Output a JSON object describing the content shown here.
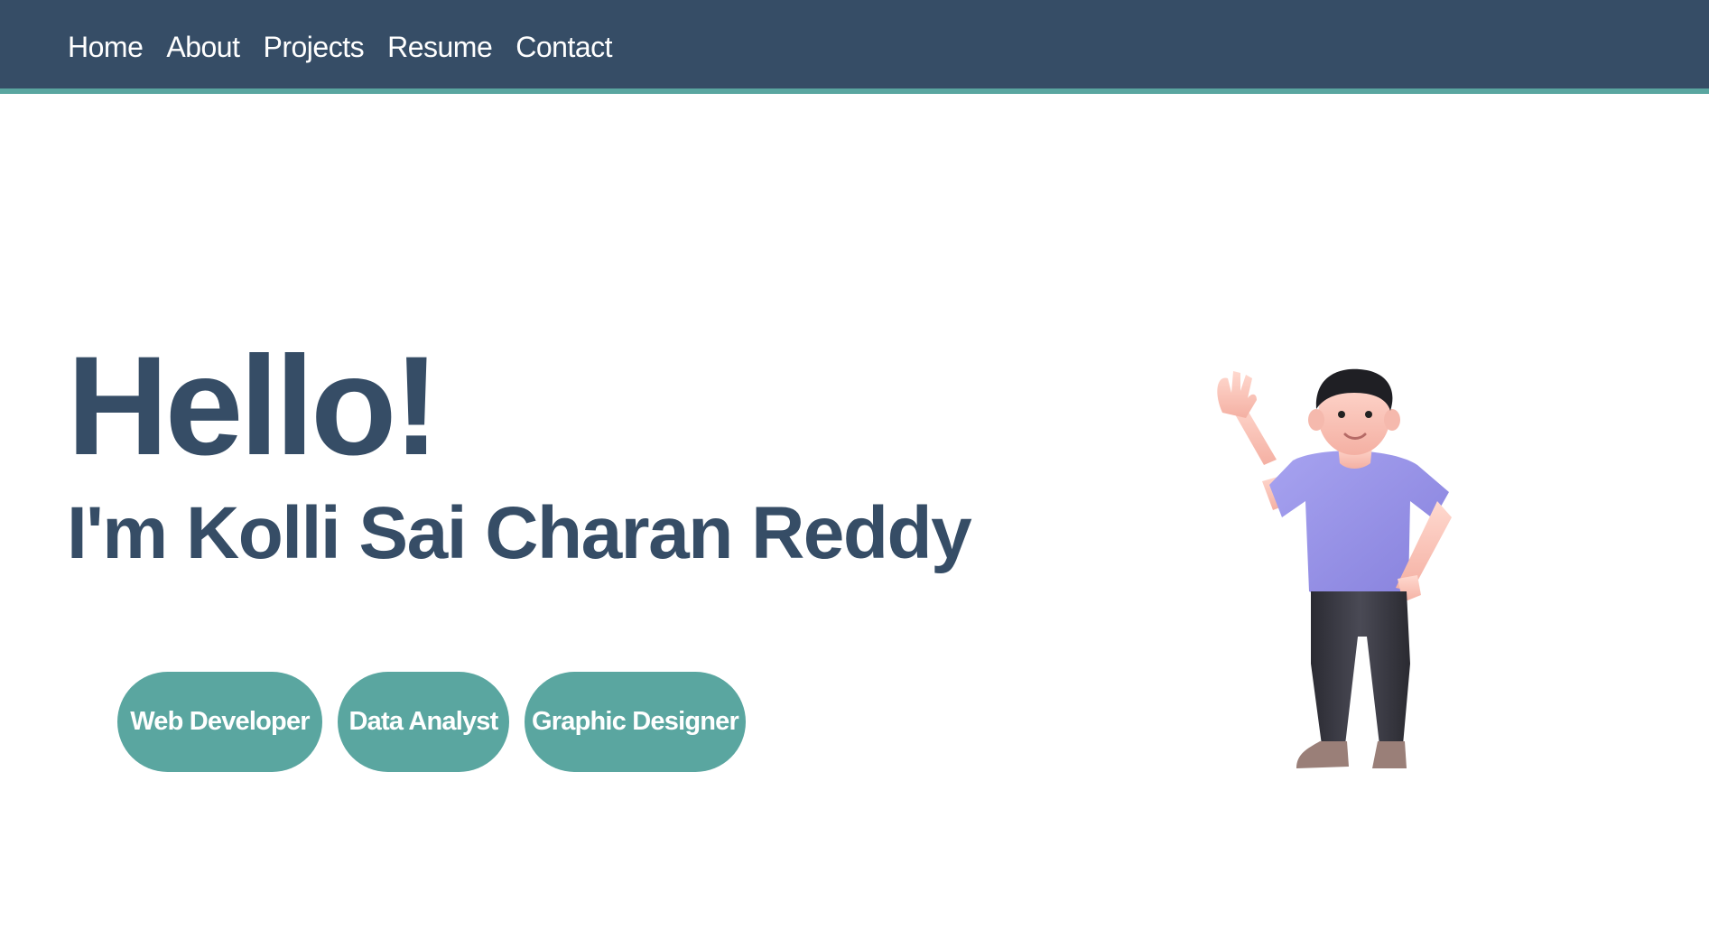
{
  "nav": {
    "links": [
      "Home",
      "About",
      "Projects",
      "Resume",
      "Contact"
    ]
  },
  "hero": {
    "greeting": "Hello!",
    "intro": "I'm Kolli Sai Charan Reddy",
    "roles": [
      "Web Developer",
      "Data Analyst",
      "Graphic Designer"
    ]
  },
  "colors": {
    "navbar": "#364d66",
    "accent": "#5aa6a0",
    "heading": "#364d66"
  },
  "icons": {
    "illustration": "waving-person-illustration"
  }
}
